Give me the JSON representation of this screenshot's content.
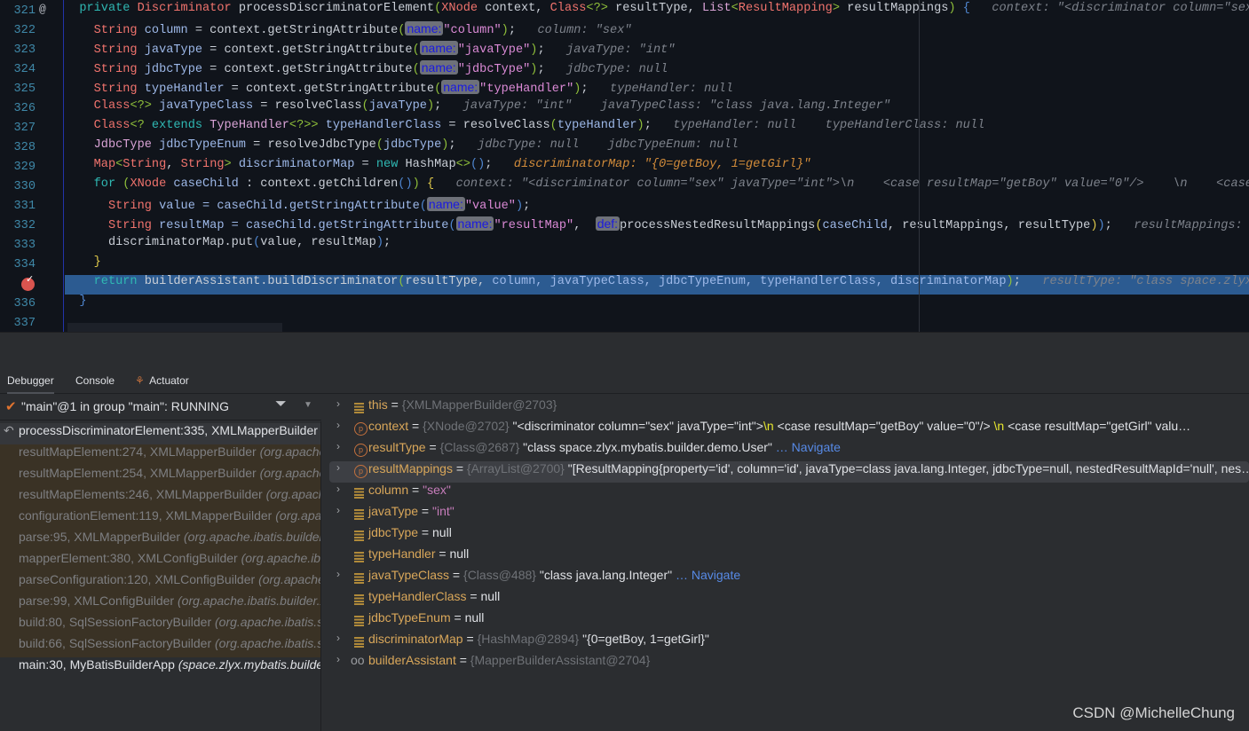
{
  "editor": {
    "line_numbers": [
      "321",
      "322",
      "323",
      "324",
      "325",
      "326",
      "327",
      "328",
      "329",
      "330",
      "331",
      "332",
      "333",
      "334",
      "335",
      "336",
      "337"
    ],
    "override_marker": "@",
    "current_line": "335",
    "lines": [
      [
        [
          "  ",
          "pu"
        ],
        [
          "private ",
          "kw"
        ],
        [
          "Discriminator ",
          "ty"
        ],
        [
          "processDiscriminatorElement",
          "fn"
        ],
        [
          "(",
          "br1"
        ],
        [
          "XNode ",
          "ty"
        ],
        [
          "context, ",
          "fn"
        ],
        [
          "Class",
          "ty"
        ],
        [
          "<?>",
          "br1"
        ],
        [
          " resultType, ",
          "fn"
        ],
        [
          "List",
          "gen"
        ],
        [
          "<",
          "br1"
        ],
        [
          "ResultMapping",
          "ty"
        ],
        [
          ">",
          "br1"
        ],
        [
          " resultMappings",
          "fn"
        ],
        [
          ")",
          "br1"
        ],
        [
          " {",
          "br2"
        ],
        [
          "   context: \"<discriminator column=\"sex\" javaType=\"int\">\\n    <case resultMap=\"getBoy\" value=\"0\"/>",
          "hint"
        ]
      ],
      [
        [
          "    ",
          "pu"
        ],
        [
          "String ",
          "ty"
        ],
        [
          "column ",
          "id"
        ],
        [
          "= context.getStringAttribute",
          "fn"
        ],
        [
          "(",
          "br1"
        ],
        [
          "name:",
          "badge"
        ],
        [
          "\"column\"",
          "st"
        ],
        [
          ")",
          "br1"
        ],
        [
          ";",
          "pu"
        ],
        [
          "   column: \"sex\"",
          "hint"
        ]
      ],
      [
        [
          "    ",
          "pu"
        ],
        [
          "String ",
          "ty"
        ],
        [
          "javaType ",
          "id"
        ],
        [
          "= context.getStringAttribute",
          "fn"
        ],
        [
          "(",
          "br1"
        ],
        [
          "name:",
          "badge"
        ],
        [
          "\"javaType\"",
          "st"
        ],
        [
          ")",
          "br1"
        ],
        [
          ";",
          "pu"
        ],
        [
          "   javaType: \"int\"",
          "hint"
        ]
      ],
      [
        [
          "    ",
          "pu"
        ],
        [
          "String ",
          "ty"
        ],
        [
          "jdbcType ",
          "id"
        ],
        [
          "= context.getStringAttribute",
          "fn"
        ],
        [
          "(",
          "br1"
        ],
        [
          "name:",
          "badge"
        ],
        [
          "\"jdbcType\"",
          "st"
        ],
        [
          ")",
          "br1"
        ],
        [
          ";",
          "pu"
        ],
        [
          "   jdbcType: null",
          "hint"
        ]
      ],
      [
        [
          "    ",
          "pu"
        ],
        [
          "String ",
          "ty"
        ],
        [
          "typeHandler ",
          "id"
        ],
        [
          "= context.getStringAttribute",
          "fn"
        ],
        [
          "(",
          "br1"
        ],
        [
          "name:",
          "badge"
        ],
        [
          "\"typeHandler\"",
          "st"
        ],
        [
          ")",
          "br1"
        ],
        [
          ";",
          "pu"
        ],
        [
          "   typeHandler: null",
          "hint"
        ]
      ],
      [
        [
          "    ",
          "pu"
        ],
        [
          "Class",
          "ty"
        ],
        [
          "<?>",
          "br1"
        ],
        [
          " javaTypeClass ",
          "id"
        ],
        [
          "= resolveClass",
          "fn"
        ],
        [
          "(",
          "br1"
        ],
        [
          "javaType",
          "id"
        ],
        [
          ")",
          "br1"
        ],
        [
          ";",
          "pu"
        ],
        [
          "   javaType: \"int\"    javaTypeClass: \"class java.lang.Integer\"",
          "hint"
        ]
      ],
      [
        [
          "    ",
          "pu"
        ],
        [
          "Class",
          "ty"
        ],
        [
          "<? ",
          "br1"
        ],
        [
          "extends ",
          "kw"
        ],
        [
          "TypeHandler",
          "gen"
        ],
        [
          "<?>",
          "br1"
        ],
        [
          "> ",
          "br1"
        ],
        [
          "typeHandlerClass ",
          "id"
        ],
        [
          "= resolveClass",
          "fn"
        ],
        [
          "(",
          "br1"
        ],
        [
          "typeHandler",
          "id"
        ],
        [
          ")",
          "br1"
        ],
        [
          ";",
          "pu"
        ],
        [
          "   typeHandler: null    typeHandlerClass: null",
          "hint"
        ]
      ],
      [
        [
          "    ",
          "pu"
        ],
        [
          "JdbcType ",
          "gen"
        ],
        [
          "jdbcTypeEnum ",
          "id"
        ],
        [
          "= resolveJdbcType",
          "fn"
        ],
        [
          "(",
          "br1"
        ],
        [
          "jdbcType",
          "id"
        ],
        [
          ")",
          "br1"
        ],
        [
          ";",
          "pu"
        ],
        [
          "   jdbcType: null    jdbcTypeEnum: null",
          "hint"
        ]
      ],
      [
        [
          "    ",
          "pu"
        ],
        [
          "Map",
          "ty"
        ],
        [
          "<",
          "br1"
        ],
        [
          "String",
          "ty"
        ],
        [
          ", ",
          "fn"
        ],
        [
          "String",
          "ty"
        ],
        [
          "> ",
          "br1"
        ],
        [
          "discriminatorMap ",
          "id"
        ],
        [
          "= ",
          "fn"
        ],
        [
          "new ",
          "kw"
        ],
        [
          "HashMap",
          "fn"
        ],
        [
          "<>",
          "br1"
        ],
        [
          "()",
          "br2"
        ],
        [
          ";",
          "pu"
        ],
        [
          "   discriminatorMap: \"{0=getBoy, 1=getGirl}\"",
          "hinto"
        ]
      ],
      [
        [
          "    ",
          "pu"
        ],
        [
          "for ",
          "kw"
        ],
        [
          "(",
          "br1"
        ],
        [
          "XNode ",
          "ty"
        ],
        [
          "caseChild ",
          "id"
        ],
        [
          ": context.getChildren",
          "fn"
        ],
        [
          "()",
          "br2"
        ],
        [
          ")",
          "br1"
        ],
        [
          " {",
          "br3"
        ],
        [
          "   context: \"<discriminator column=\"sex\" javaType=\"int\">\\n    <case resultMap=\"getBoy\" value=\"0\"/>    \\n    <case resultMap=\"getGirl\"",
          "hint"
        ]
      ],
      [
        [
          "      ",
          "pu"
        ],
        [
          "String ",
          "ty"
        ],
        [
          "value ",
          "id"
        ],
        [
          "= caseChild.getStringAttribute",
          "id"
        ],
        [
          "(",
          "br2"
        ],
        [
          "name:",
          "badge"
        ],
        [
          "\"value\"",
          "st"
        ],
        [
          ")",
          "br2"
        ],
        [
          ";",
          "pu"
        ]
      ],
      [
        [
          "      ",
          "pu"
        ],
        [
          "String ",
          "ty"
        ],
        [
          "resultMap ",
          "id"
        ],
        [
          "= caseChild.getStringAttribute",
          "id"
        ],
        [
          "(",
          "br2"
        ],
        [
          "name:",
          "badge"
        ],
        [
          "\"resultMap\"",
          "st"
        ],
        [
          ",  ",
          "pu"
        ],
        [
          "def:",
          "badge"
        ],
        [
          "processNestedResultMappings",
          "fn"
        ],
        [
          "(",
          "br3"
        ],
        [
          "caseChild",
          "id"
        ],
        [
          ", resultMappings, resultType",
          "fn"
        ],
        [
          ")",
          "br3"
        ],
        [
          ")",
          "br2"
        ],
        [
          ";",
          "pu"
        ],
        [
          "   resultMappings: \"[ResultMapping{property='id'",
          "hint"
        ]
      ],
      [
        [
          "      ",
          "pu"
        ],
        [
          "discriminatorMap.put",
          "fn"
        ],
        [
          "(",
          "br2"
        ],
        [
          "value, resultMap",
          "fn"
        ],
        [
          ")",
          "br2"
        ],
        [
          ";",
          "pu"
        ]
      ],
      [
        [
          "    ",
          "pu"
        ],
        [
          "}",
          "br3"
        ]
      ],
      [
        [
          "    ",
          "pu"
        ],
        [
          "return ",
          "kw"
        ],
        [
          "builderAssistant.buildDiscriminator",
          "fn"
        ],
        [
          "(",
          "br1"
        ],
        [
          "resultType, ",
          "fn"
        ],
        [
          "column, javaTypeClass, jdbcTypeEnum, typeHandlerClass, discriminatorMap",
          "id"
        ],
        [
          ")",
          "br1"
        ],
        [
          ";",
          "pu"
        ],
        [
          "   resultType: \"class space.zlyx.mybatis.builder.demo.User\"",
          "hint"
        ]
      ],
      [
        [
          "  ",
          "pu"
        ],
        [
          "}",
          "br2"
        ]
      ],
      []
    ]
  },
  "tool_window": {
    "tabs": [
      {
        "label": "Debugger",
        "active": true
      },
      {
        "label": "Console"
      },
      {
        "label": "Actuator"
      }
    ],
    "thread": {
      "label": "\"main\"@1 in group \"main\": RUNNING",
      "icon": "check-icon"
    },
    "frames": [
      {
        "method": "processDiscriminatorElement:335, XMLMapperBuilder",
        "pkg": "(org.apache.ibatis.builder.xml)",
        "state": "current"
      },
      {
        "method": "resultMapElement:274, XMLMapperBuilder",
        "pkg": "(org.apache.ibatis.builder.xml)"
      },
      {
        "method": "resultMapElement:254, XMLMapperBuilder",
        "pkg": "(org.apache.ibatis.builder.xml)"
      },
      {
        "method": "resultMapElements:246, XMLMapperBuilder",
        "pkg": "(org.apache.ibatis.builder.xml)"
      },
      {
        "method": "configurationElement:119, XMLMapperBuilder",
        "pkg": "(org.apache.ibatis.builder.xml)"
      },
      {
        "method": "parse:95, XMLMapperBuilder",
        "pkg": "(org.apache.ibatis.builder.xml)"
      },
      {
        "method": "mapperElement:380, XMLConfigBuilder",
        "pkg": "(org.apache.ibatis.builder.xml)"
      },
      {
        "method": "parseConfiguration:120, XMLConfigBuilder",
        "pkg": "(org.apache.ibatis.builder.xml)"
      },
      {
        "method": "parse:99, XMLConfigBuilder",
        "pkg": "(org.apache.ibatis.builder.xml)"
      },
      {
        "method": "build:80, SqlSessionFactoryBuilder",
        "pkg": "(org.apache.ibatis.session)"
      },
      {
        "method": "build:66, SqlSessionFactoryBuilder",
        "pkg": "(org.apache.ibatis.session)"
      },
      {
        "method": "main:30, MyBatisBuilderApp",
        "pkg": "(space.zlyx.mybatis.builder)",
        "state": "plain"
      }
    ],
    "variables": [
      {
        "name": "this",
        "ref": "{XMLMapperBuilder@2703}",
        "icon": "field",
        "expandable": true
      },
      {
        "name": "context",
        "ref": "{XNode@2702}",
        "value": "\"<discriminator column=\"sex\" javaType=\"int\">",
        "extra": "\\n",
        "value2": "    <case resultMap=\"getBoy\" value=\"0\"/>    ",
        "extra2": "\\n",
        "value3": "    <case resultMap=\"getGirl\" valu…",
        "icon": "param",
        "expandable": true
      },
      {
        "name": "resultType",
        "ref": "{Class@2687}",
        "value": "\"class space.zlyx.mybatis.builder.demo.User\"",
        "nav": " … Navigate",
        "icon": "param",
        "expandable": true
      },
      {
        "name": "resultMappings",
        "ref": "{ArrayList@2700}",
        "value": "\"[ResultMapping{property='id', column='id', javaType=class java.lang.Integer, jdbcType=null, nestedResultMapId='null', nes…",
        "icon": "param",
        "expandable": true,
        "selected": true
      },
      {
        "name": "column",
        "strval": "\"sex\"",
        "icon": "field",
        "expandable": true
      },
      {
        "name": "javaType",
        "strval": "\"int\"",
        "icon": "field",
        "expandable": true
      },
      {
        "name": "jdbcType",
        "plain": "null",
        "icon": "field"
      },
      {
        "name": "typeHandler",
        "plain": "null",
        "icon": "field"
      },
      {
        "name": "javaTypeClass",
        "ref": "{Class@488}",
        "value": "\"class java.lang.Integer\"",
        "nav": " … Navigate",
        "icon": "field",
        "expandable": true
      },
      {
        "name": "typeHandlerClass",
        "plain": "null",
        "icon": "field"
      },
      {
        "name": "jdbcTypeEnum",
        "plain": "null",
        "icon": "field"
      },
      {
        "name": "discriminatorMap",
        "ref": "{HashMap@2894}",
        "value": "\"{0=getBoy, 1=getGirl}\"",
        "icon": "field",
        "expandable": true
      },
      {
        "name": "builderAssistant",
        "ref": "{MapperBuilderAssistant@2704}",
        "icon": "watch",
        "expandable": true
      }
    ]
  },
  "watermark": "CSDN @MichelleChung"
}
